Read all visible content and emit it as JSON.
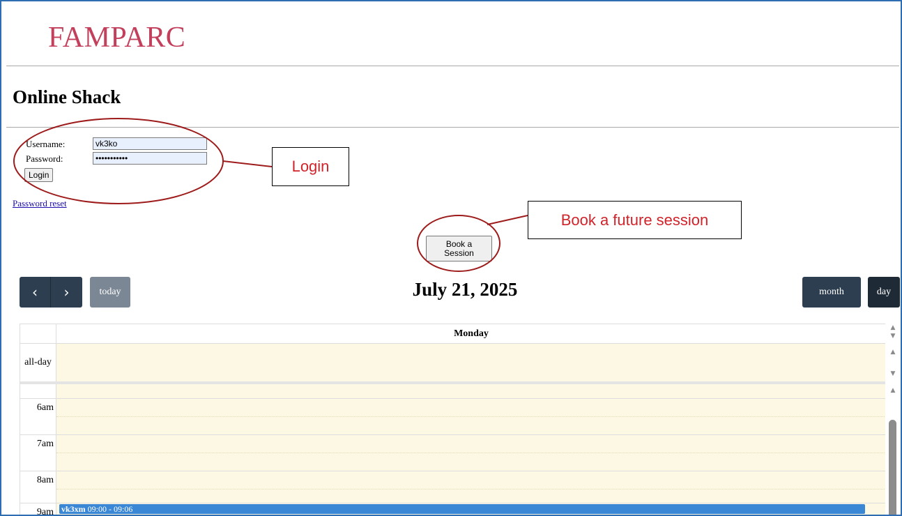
{
  "site": {
    "logo": "FAMPARC"
  },
  "page": {
    "title": "Online Shack"
  },
  "login_form": {
    "username_label": "Username:",
    "username_value": "vk3ko",
    "password_label": "Password:",
    "password_value": "•••••••••••",
    "login_button": "Login",
    "password_reset_link": "Password reset"
  },
  "annotations": {
    "login_callout": "Login",
    "book_callout": "Book a future session",
    "callout_color": "#d0232a",
    "circle_color": "#9e1b1b"
  },
  "booking": {
    "button_label": "Book a\nSession"
  },
  "calendar": {
    "prev_icon": "chevron-left-icon",
    "next_icon": "chevron-right-icon",
    "today_button": "today",
    "title": "July 21, 2025",
    "month_button": "month",
    "day_button": "day",
    "day_column_header": "Monday",
    "allday_label": "all-day",
    "hours": [
      "6am",
      "7am",
      "8am",
      "9am"
    ],
    "event": {
      "title": "vk3xm",
      "time": "09:00 - 09:06",
      "color": "#3a87d6"
    }
  }
}
